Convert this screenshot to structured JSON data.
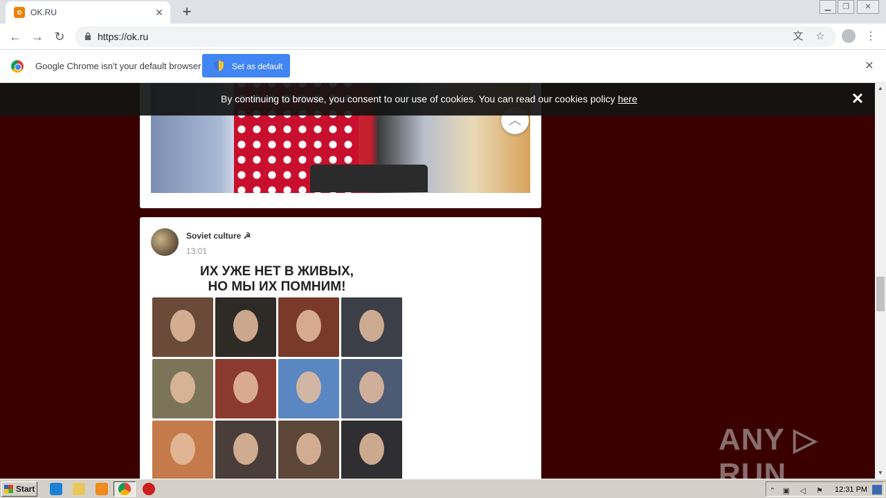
{
  "browser": {
    "tab_title": "OK.RU",
    "tab_favicon_letter": "o",
    "url": "https://ok.ru"
  },
  "infobar": {
    "message": "Google Chrome isn't your default browser",
    "button_label": "Set as default"
  },
  "cookie_bar": {
    "text": "By continuing to browse, you consent to our use of cookies. You can read our cookies policy ",
    "link_text": "here"
  },
  "post": {
    "author": "Soviet culture ☭",
    "time": "13:01",
    "headline_line1": "ИХ УЖЕ НЕТ В ЖИВЫХ,",
    "headline_line2": "НО МЫ ИХ ПОМНИМ!"
  },
  "photo_grid": {
    "cells": [
      {
        "color": "#6b4a3a"
      },
      {
        "color": "#2e2a26"
      },
      {
        "color": "#7a3a2a"
      },
      {
        "color": "#3c3f47"
      },
      {
        "color": "#7c7458"
      },
      {
        "color": "#8a3a2e"
      },
      {
        "color": "#5a86c2"
      },
      {
        "color": "#4d5a73"
      },
      {
        "color": "#c47a4a"
      },
      {
        "color": "#4a3e3a"
      },
      {
        "color": "#5c4638"
      },
      {
        "color": "#2f2f33"
      }
    ]
  },
  "watermark": "ANY ▷ RUN",
  "taskbar": {
    "start_label": "Start",
    "clock": "12:31 PM"
  },
  "colors": {
    "page_background": "#3a0000",
    "accent_button": "#4285f4",
    "ok_orange": "#ee8208"
  }
}
